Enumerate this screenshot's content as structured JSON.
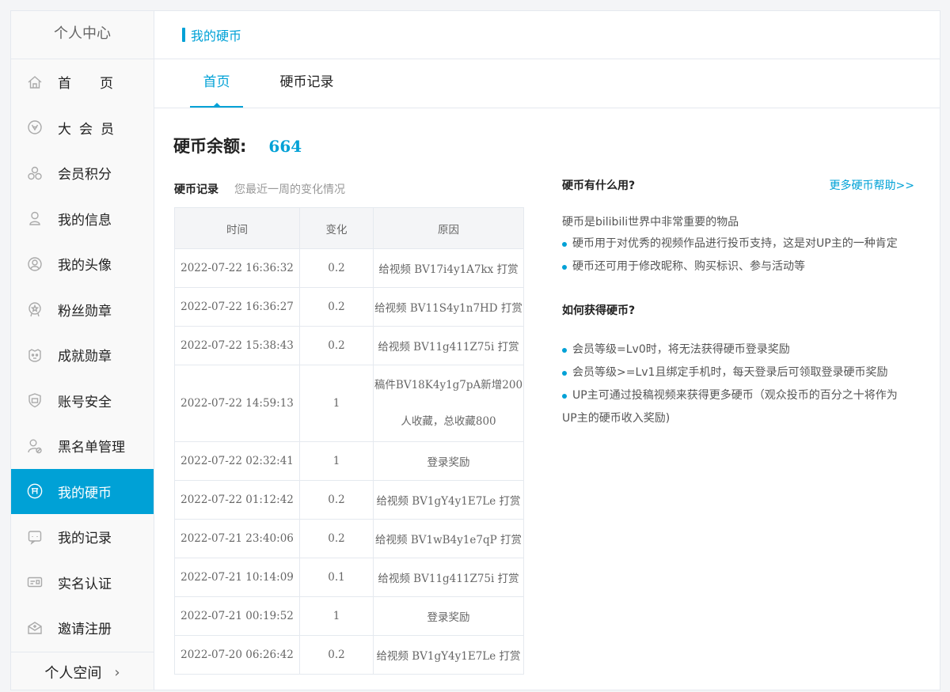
{
  "sidebar": {
    "header": "个人中心",
    "items": [
      {
        "label": "首页",
        "icon": "home-icon"
      },
      {
        "label": "大会员",
        "icon": "vip-icon"
      },
      {
        "label": "会员积分",
        "icon": "points-icon"
      },
      {
        "label": "我的信息",
        "icon": "user-info-icon"
      },
      {
        "label": "我的头像",
        "icon": "avatar-icon"
      },
      {
        "label": "粉丝勋章",
        "icon": "fan-medal-icon"
      },
      {
        "label": "成就勋章",
        "icon": "achievement-icon"
      },
      {
        "label": "账号安全",
        "icon": "shield-icon"
      },
      {
        "label": "黑名单管理",
        "icon": "blacklist-icon"
      },
      {
        "label": "我的硬币",
        "icon": "coin-icon"
      },
      {
        "label": "我的记录",
        "icon": "record-icon"
      },
      {
        "label": "实名认证",
        "icon": "id-card-icon"
      },
      {
        "label": "邀请注册",
        "icon": "invite-icon"
      }
    ],
    "active_index": 9,
    "footer": "个人空间"
  },
  "header": {
    "title": "我的硬币"
  },
  "tabs": [
    {
      "label": "首页"
    },
    {
      "label": "硬币记录"
    }
  ],
  "balance": {
    "label": "硬币余额:",
    "value": "664"
  },
  "records": {
    "title": "硬币记录",
    "subtitle": "您最近一周的变化情况",
    "columns": [
      "时间",
      "变化",
      "原因"
    ],
    "rows": [
      {
        "time": "2022-07-22 16:36:32",
        "change": "0.2",
        "reason": "给视频 BV17i4y1A7kx 打赏"
      },
      {
        "time": "2022-07-22 16:36:27",
        "change": "0.2",
        "reason": "给视频 BV11S4y1n7HD 打赏"
      },
      {
        "time": "2022-07-22 15:38:43",
        "change": "0.2",
        "reason": "给视频 BV11g411Z75i 打赏"
      },
      {
        "time": "2022-07-22 14:59:13",
        "change": "1",
        "reason_line1": "稿件BV18K4y1g7pA新增200",
        "reason_line2": "人收藏，总收藏800"
      },
      {
        "time": "2022-07-22 02:32:41",
        "change": "1",
        "reason": "登录奖励"
      },
      {
        "time": "2022-07-22 01:12:42",
        "change": "0.2",
        "reason": "给视频 BV1gY4y1E7Le 打赏"
      },
      {
        "time": "2022-07-21 23:40:06",
        "change": "0.2",
        "reason": "给视频 BV1wB4y1e7qP 打赏"
      },
      {
        "time": "2022-07-21 10:14:09",
        "change": "0.1",
        "reason": "给视频 BV11g411Z75i 打赏"
      },
      {
        "time": "2022-07-21 00:19:52",
        "change": "1",
        "reason": "登录奖励"
      },
      {
        "time": "2022-07-20 06:26:42",
        "change": "0.2",
        "reason": "给视频 BV1gY4y1E7Le 打赏"
      }
    ]
  },
  "help": {
    "q1": "硬币有什么用?",
    "more": "更多硬币帮助>>",
    "intro": "硬币是bilibili世界中非常重要的物品",
    "uses": [
      "硬币用于对优秀的视频作品进行投币支持，这是对UP主的一种肯定",
      "硬币还可用于修改昵称、购买标识、参与活动等"
    ],
    "q2": "如何获得硬币?",
    "ways": [
      "会员等级=Lv0时，将无法获得硬币登录奖励",
      "会员等级>=Lv1且绑定手机时，每天登录后可领取登录硬币奖励"
    ],
    "way3_line1": "UP主可通过投稿视频来获得更多硬币（观众投币的百分之十将作为",
    "way3_line2": "UP主的硬币收入奖励)"
  },
  "colors": {
    "accent": "#00a1d6",
    "border": "#e5e9ef"
  }
}
